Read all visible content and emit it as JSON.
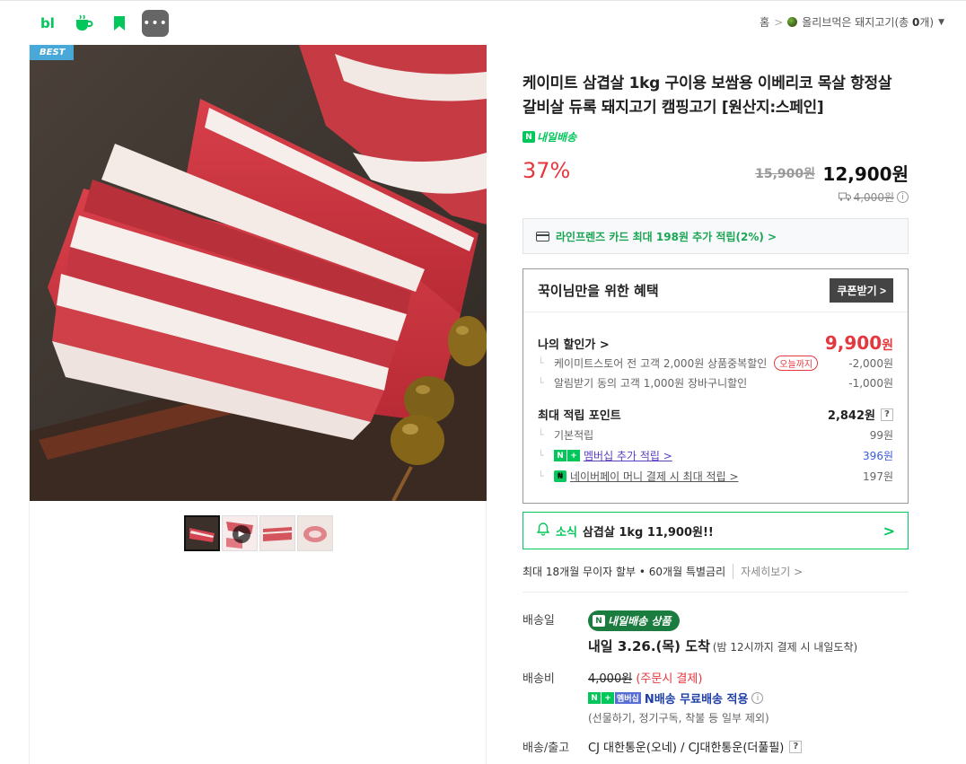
{
  "topbar": {
    "icons": [
      "blog-icon",
      "cafe-icon",
      "bookmark-icon",
      "more-icon"
    ],
    "blog_label": "bl",
    "more_label": "•••",
    "breadcrumb_home": "홈",
    "breadcrumb_sep": ">",
    "store_name": "올리브먹은 돼지고기",
    "store_count_prefix": "(총 ",
    "store_count": "0",
    "store_count_suffix": "개)"
  },
  "gallery": {
    "best_badge": "BEST",
    "thumbnail_count": 4,
    "play_label": "▶"
  },
  "product": {
    "title": "케이미트 삼겹살 1kg 구이용 보쌈용 이베리코 목살 항정살 갈비살 듀록 돼지고기 캠핑고기 [원산지:스페인]",
    "delivery_badge": "내일배송",
    "delivery_n": "N",
    "discount_rate": "37%",
    "original_price": "15,900원",
    "price": "12,900원",
    "shipping_original": "4,000원",
    "info_mark": "i"
  },
  "card_promo": {
    "text": "라인프렌즈 카드 최대 198원 추가 적립(2%) >"
  },
  "benefit": {
    "title": "꾹이님만을 위한 혜택",
    "coupon_button": "쿠폰받기 >",
    "my_price_label": "나의 할인가 >",
    "my_price": "9,900",
    "my_price_unit": "원",
    "discounts": [
      {
        "label": "케이미트스토어 전 고객 2,000원 상품중복할인",
        "tag": "오늘까지",
        "value": "-2,000원"
      },
      {
        "label": "알림받기 동의 고객 1,000원 장바구니할인",
        "value": "-1,000원"
      }
    ],
    "points_label": "최대 적립 포인트",
    "points_value": "2,842원",
    "help_mark": "?",
    "points": [
      {
        "label": "기본적립",
        "value": "99원"
      },
      {
        "label": "멤버십 추가 적립 >",
        "value": "396원"
      },
      {
        "label": "네이버페이 머니 결제 시 최대 적립 >",
        "value": "197원"
      }
    ]
  },
  "notice": {
    "tag": "소식",
    "text": "삼겹살 1kg 11,900원!!",
    "arrow": ">"
  },
  "installment": {
    "text": "최대 18개월 무이자 할부 • 60개월 특별금리",
    "more": "자세히보기 >"
  },
  "delivery": {
    "date_label": "배송일",
    "badge": "내일배송 상품",
    "arrival_main": "내일 3.26.(목) 도착",
    "arrival_note": "(밤 12시까지 결제 시 내일도착)",
    "fee_label": "배송비",
    "fee_original": "4,000원",
    "fee_note": "(주문시 결제)",
    "membership_badge": "멤버십",
    "free_ship": "N배송 무료배송 적용",
    "exceptions": "(선물하기, 정기구독, 착불 등 일부 제외)",
    "carrier_label": "배송/출고",
    "carrier": "CJ 대한통운(오네) / CJ대한통운(더풀필)"
  },
  "colors": {
    "naver_green": "#03c75a",
    "discount_red": "#e4383e",
    "best_blue": "#48a9d8"
  }
}
